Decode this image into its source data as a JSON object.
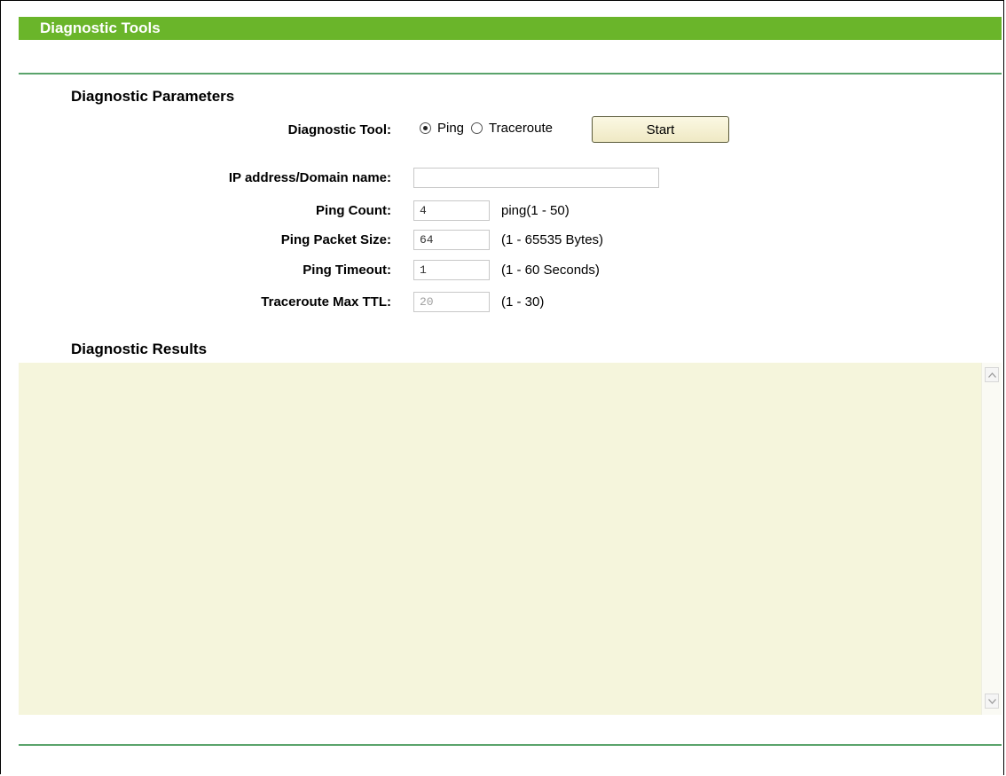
{
  "page": {
    "title": "Diagnostic Tools"
  },
  "parameters": {
    "heading": "Diagnostic Parameters",
    "tool": {
      "label": "Diagnostic Tool:",
      "options": [
        "Ping",
        "Traceroute"
      ],
      "selected": "Ping",
      "start_label": "Start"
    },
    "ip_address": {
      "label": "IP address/Domain name:",
      "value": ""
    },
    "ping_count": {
      "label": "Ping Count:",
      "value": "4",
      "hint": "ping(1 - 50)"
    },
    "ping_packet_size": {
      "label": "Ping Packet Size:",
      "value": "64",
      "hint": "(1 - 65535 Bytes)"
    },
    "ping_timeout": {
      "label": "Ping Timeout:",
      "value": "1",
      "hint": "(1 - 60 Seconds)"
    },
    "traceroute_max_ttl": {
      "label": "Traceroute Max TTL:",
      "value": "20",
      "hint": "(1 - 30)",
      "disabled": true
    }
  },
  "results": {
    "heading": "Diagnostic Results",
    "content": ""
  },
  "colors": {
    "header": "#6ab52a",
    "rule": "#5aa36b",
    "results_bg": "#f5f5dc"
  }
}
